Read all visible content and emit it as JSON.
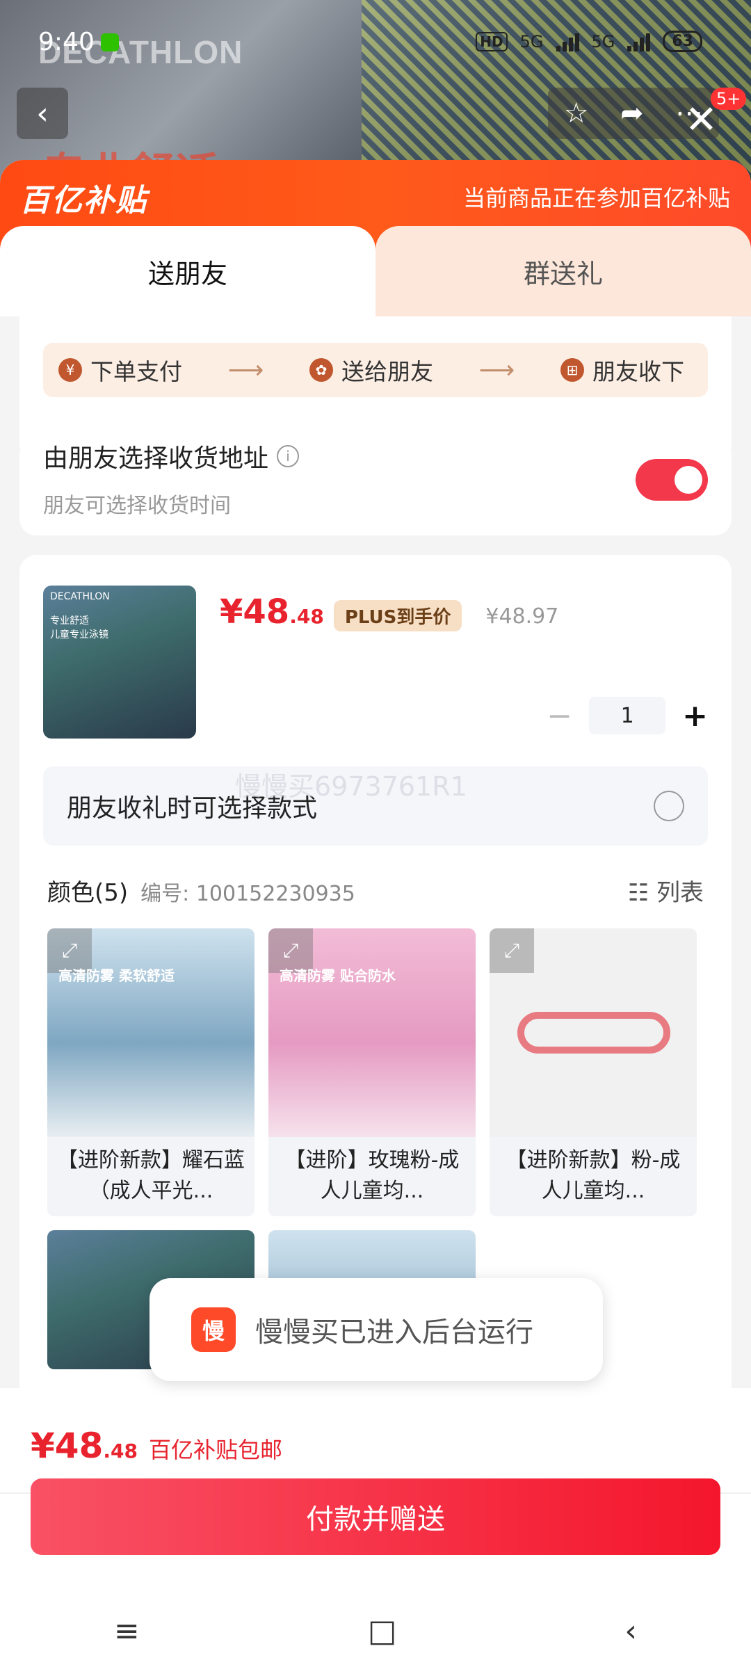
{
  "status_bar": {
    "time": "9:40",
    "net1": "5G",
    "net2": "5G",
    "battery": "63",
    "hd": "HD"
  },
  "hero": {
    "brand": "DECATHLON",
    "big_text": "专业舒适"
  },
  "top": {
    "back": "‹",
    "badge": "5+",
    "close": "✕"
  },
  "banner": {
    "logo": "百亿补贴",
    "notice": "当前商品正在参加百亿补贴"
  },
  "tabs": [
    {
      "label": "送朋友"
    },
    {
      "label": "群送礼"
    }
  ],
  "steps": [
    {
      "icon": "¥",
      "label": "下单支付"
    },
    {
      "icon": "✿",
      "label": "送给朋友"
    },
    {
      "icon": "⊞",
      "label": "朋友收下"
    }
  ],
  "address": {
    "title": "由朋友选择收货地址",
    "subtitle": "朋友可选择收货时间",
    "info": "i"
  },
  "product": {
    "img_brand": "DECATHLON",
    "img_line1": "专业舒适",
    "img_line2": "儿童专业泳镜",
    "price_int": "¥48",
    "price_dec": ".48",
    "plus_label": "PLUS到手价",
    "old_price": "¥48.97",
    "qty": "1",
    "minus": "−",
    "plus": "+"
  },
  "choose_style": "朋友收礼时可选择款式",
  "watermark": "慢慢买6973761R1",
  "colors": {
    "title": "颜色(5)",
    "code": "编号: 100152230935",
    "view": "列表",
    "items": [
      {
        "name": "【进阶新款】耀石蓝（成人平光...",
        "cap": "高清防雾 柔软舒适"
      },
      {
        "name": "【进阶】玫瑰粉-成人儿童均...",
        "cap": "高清防雾 贴合防水"
      },
      {
        "name": "【进阶新款】粉-成人儿童均...",
        "cap": ""
      }
    ]
  },
  "toast": {
    "app_icon": "慢",
    "text": "慢慢买已进入后台运行"
  },
  "footer": {
    "price_int": "¥48",
    "price_dec": ".48",
    "label": "百亿补贴包邮",
    "pay_button": "付款并赠送"
  },
  "navbar": {
    "menu": "≡",
    "home": "□",
    "back": "‹"
  }
}
